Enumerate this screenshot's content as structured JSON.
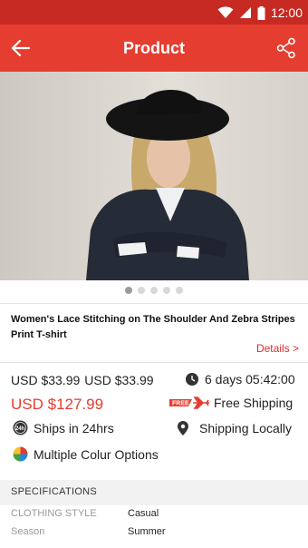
{
  "status_bar": {
    "time": "12:00"
  },
  "app_bar": {
    "title": "Product"
  },
  "gallery": {
    "dot_count": 5,
    "active_index": 0
  },
  "product": {
    "title": "Women's Lace Stitching on The Shoulder And Zebra Stripes Print T-shirt",
    "details_link": "Details >"
  },
  "pricing": {
    "old_price_1": "USD $33.99",
    "old_price_2": "USD $33.99",
    "new_price": "USD $127.99",
    "countdown": "6 days 05:42:00"
  },
  "shipping": {
    "free_badge": "FREE",
    "free_label": "Free Shipping",
    "ships_24_badge": "24h",
    "ships_24_label": "Ships in 24hrs",
    "local_label": "Shipping Locally"
  },
  "options": {
    "colour_label": "Multiple Colur Options"
  },
  "specifications": {
    "header": "SPECIFICATIONS",
    "rows": [
      {
        "key": "CLOTHING STYLE",
        "value": "Casual"
      },
      {
        "key": "Season",
        "value": "Summer"
      }
    ]
  },
  "colors": {
    "accent": "#e53d30",
    "status_bar": "#c62a23",
    "price_red": "#e53d30"
  }
}
